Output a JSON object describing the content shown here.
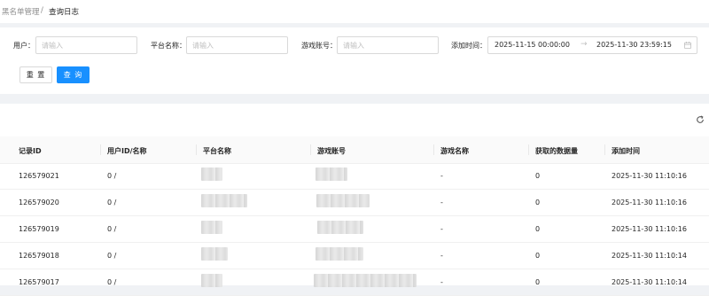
{
  "breadcrumb": {
    "root": "黑名单管理",
    "separator": "/",
    "current": "查询日志"
  },
  "filters": {
    "user_label": "用户：",
    "user_placeholder": "请输入",
    "platform_label": "平台名称：",
    "platform_placeholder": "请输入",
    "account_label": "游戏账号：",
    "account_placeholder": "请输入",
    "time_label": "添加时间：",
    "time_start": "2025-11-15 00:00:00",
    "time_end": "2025-11-30 23:59:15",
    "range_arrow": "→"
  },
  "buttons": {
    "reset": "重 置",
    "query": "查 询"
  },
  "icons": {
    "refresh": "refresh-icon",
    "calendar": "calendar-icon"
  },
  "colors": {
    "primary": "#1890ff",
    "header_bg": "#fafafa",
    "page_bg": "#f0f2f5"
  },
  "table": {
    "columns": [
      "记录ID",
      "用户ID/名称",
      "平台名称",
      "游戏账号",
      "游戏名称",
      "获取的数据量",
      "添加时间"
    ],
    "rows": [
      {
        "id": "126579021",
        "user": "0 /",
        "game": "-",
        "count": "0",
        "time": "2025-11-30 11:10:16"
      },
      {
        "id": "126579020",
        "user": "0 /",
        "game": "-",
        "count": "0",
        "time": "2025-11-30 11:10:16"
      },
      {
        "id": "126579019",
        "user": "0 /",
        "game": "-",
        "count": "0",
        "time": "2025-11-30 11:10:16"
      },
      {
        "id": "126579018",
        "user": "0 /",
        "game": "-",
        "count": "0",
        "time": "2025-11-30 11:10:14"
      },
      {
        "id": "126579017",
        "user": "0 /",
        "game": "-",
        "count": "0",
        "time": "2025-11-30 11:10:14"
      }
    ]
  }
}
